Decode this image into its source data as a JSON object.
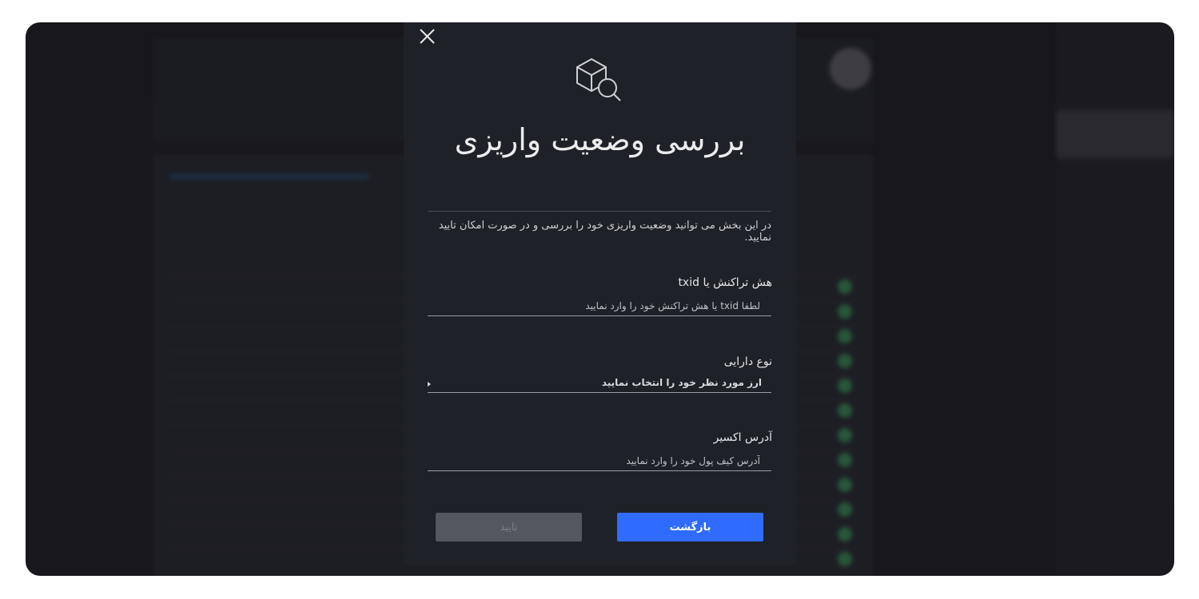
{
  "modal": {
    "title": "بررسی وضعیت واریزی",
    "description": "در این بخش می توانید وضعیت واریزی خود را بررسی و در صورت امکان تایید نمایید.",
    "icon": "package-search-icon",
    "close_icon": "close-icon",
    "fields": {
      "txid": {
        "label": "هش تراکنش یا txid",
        "placeholder": "لطفا txid یا هش تراکنش خود را وارد نمایید",
        "value": ""
      },
      "asset": {
        "label": "نوع دارایی",
        "selected": "ارز مورد نظر خود را انتخاب نمایید"
      },
      "address": {
        "label": "آدرس اکسیر",
        "placeholder": "آدرس کیف پول خود را وارد نمایید",
        "value": ""
      }
    },
    "buttons": {
      "back": "بازگشت",
      "confirm": "تایید"
    }
  },
  "colors": {
    "accent": "#2f6bff",
    "modal_bg": "#1f2129",
    "overlay_bg": "#18181c"
  }
}
